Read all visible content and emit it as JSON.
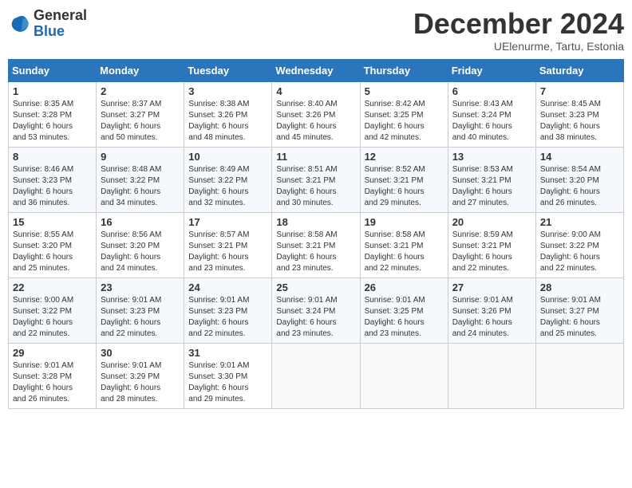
{
  "header": {
    "logo_general": "General",
    "logo_blue": "Blue",
    "month_title": "December 2024",
    "subtitle": "UElenurme, Tartu, Estonia"
  },
  "weekdays": [
    "Sunday",
    "Monday",
    "Tuesday",
    "Wednesday",
    "Thursday",
    "Friday",
    "Saturday"
  ],
  "weeks": [
    [
      {
        "day": "1",
        "info": "Sunrise: 8:35 AM\nSunset: 3:28 PM\nDaylight: 6 hours\nand 53 minutes."
      },
      {
        "day": "2",
        "info": "Sunrise: 8:37 AM\nSunset: 3:27 PM\nDaylight: 6 hours\nand 50 minutes."
      },
      {
        "day": "3",
        "info": "Sunrise: 8:38 AM\nSunset: 3:26 PM\nDaylight: 6 hours\nand 48 minutes."
      },
      {
        "day": "4",
        "info": "Sunrise: 8:40 AM\nSunset: 3:26 PM\nDaylight: 6 hours\nand 45 minutes."
      },
      {
        "day": "5",
        "info": "Sunrise: 8:42 AM\nSunset: 3:25 PM\nDaylight: 6 hours\nand 42 minutes."
      },
      {
        "day": "6",
        "info": "Sunrise: 8:43 AM\nSunset: 3:24 PM\nDaylight: 6 hours\nand 40 minutes."
      },
      {
        "day": "7",
        "info": "Sunrise: 8:45 AM\nSunset: 3:23 PM\nDaylight: 6 hours\nand 38 minutes."
      }
    ],
    [
      {
        "day": "8",
        "info": "Sunrise: 8:46 AM\nSunset: 3:23 PM\nDaylight: 6 hours\nand 36 minutes."
      },
      {
        "day": "9",
        "info": "Sunrise: 8:48 AM\nSunset: 3:22 PM\nDaylight: 6 hours\nand 34 minutes."
      },
      {
        "day": "10",
        "info": "Sunrise: 8:49 AM\nSunset: 3:22 PM\nDaylight: 6 hours\nand 32 minutes."
      },
      {
        "day": "11",
        "info": "Sunrise: 8:51 AM\nSunset: 3:21 PM\nDaylight: 6 hours\nand 30 minutes."
      },
      {
        "day": "12",
        "info": "Sunrise: 8:52 AM\nSunset: 3:21 PM\nDaylight: 6 hours\nand 29 minutes."
      },
      {
        "day": "13",
        "info": "Sunrise: 8:53 AM\nSunset: 3:21 PM\nDaylight: 6 hours\nand 27 minutes."
      },
      {
        "day": "14",
        "info": "Sunrise: 8:54 AM\nSunset: 3:20 PM\nDaylight: 6 hours\nand 26 minutes."
      }
    ],
    [
      {
        "day": "15",
        "info": "Sunrise: 8:55 AM\nSunset: 3:20 PM\nDaylight: 6 hours\nand 25 minutes."
      },
      {
        "day": "16",
        "info": "Sunrise: 8:56 AM\nSunset: 3:20 PM\nDaylight: 6 hours\nand 24 minutes."
      },
      {
        "day": "17",
        "info": "Sunrise: 8:57 AM\nSunset: 3:21 PM\nDaylight: 6 hours\nand 23 minutes."
      },
      {
        "day": "18",
        "info": "Sunrise: 8:58 AM\nSunset: 3:21 PM\nDaylight: 6 hours\nand 23 minutes."
      },
      {
        "day": "19",
        "info": "Sunrise: 8:58 AM\nSunset: 3:21 PM\nDaylight: 6 hours\nand 22 minutes."
      },
      {
        "day": "20",
        "info": "Sunrise: 8:59 AM\nSunset: 3:21 PM\nDaylight: 6 hours\nand 22 minutes."
      },
      {
        "day": "21",
        "info": "Sunrise: 9:00 AM\nSunset: 3:22 PM\nDaylight: 6 hours\nand 22 minutes."
      }
    ],
    [
      {
        "day": "22",
        "info": "Sunrise: 9:00 AM\nSunset: 3:22 PM\nDaylight: 6 hours\nand 22 minutes."
      },
      {
        "day": "23",
        "info": "Sunrise: 9:01 AM\nSunset: 3:23 PM\nDaylight: 6 hours\nand 22 minutes."
      },
      {
        "day": "24",
        "info": "Sunrise: 9:01 AM\nSunset: 3:23 PM\nDaylight: 6 hours\nand 22 minutes."
      },
      {
        "day": "25",
        "info": "Sunrise: 9:01 AM\nSunset: 3:24 PM\nDaylight: 6 hours\nand 23 minutes."
      },
      {
        "day": "26",
        "info": "Sunrise: 9:01 AM\nSunset: 3:25 PM\nDaylight: 6 hours\nand 23 minutes."
      },
      {
        "day": "27",
        "info": "Sunrise: 9:01 AM\nSunset: 3:26 PM\nDaylight: 6 hours\nand 24 minutes."
      },
      {
        "day": "28",
        "info": "Sunrise: 9:01 AM\nSunset: 3:27 PM\nDaylight: 6 hours\nand 25 minutes."
      }
    ],
    [
      {
        "day": "29",
        "info": "Sunrise: 9:01 AM\nSunset: 3:28 PM\nDaylight: 6 hours\nand 26 minutes."
      },
      {
        "day": "30",
        "info": "Sunrise: 9:01 AM\nSunset: 3:29 PM\nDaylight: 6 hours\nand 28 minutes."
      },
      {
        "day": "31",
        "info": "Sunrise: 9:01 AM\nSunset: 3:30 PM\nDaylight: 6 hours\nand 29 minutes."
      },
      null,
      null,
      null,
      null
    ]
  ]
}
